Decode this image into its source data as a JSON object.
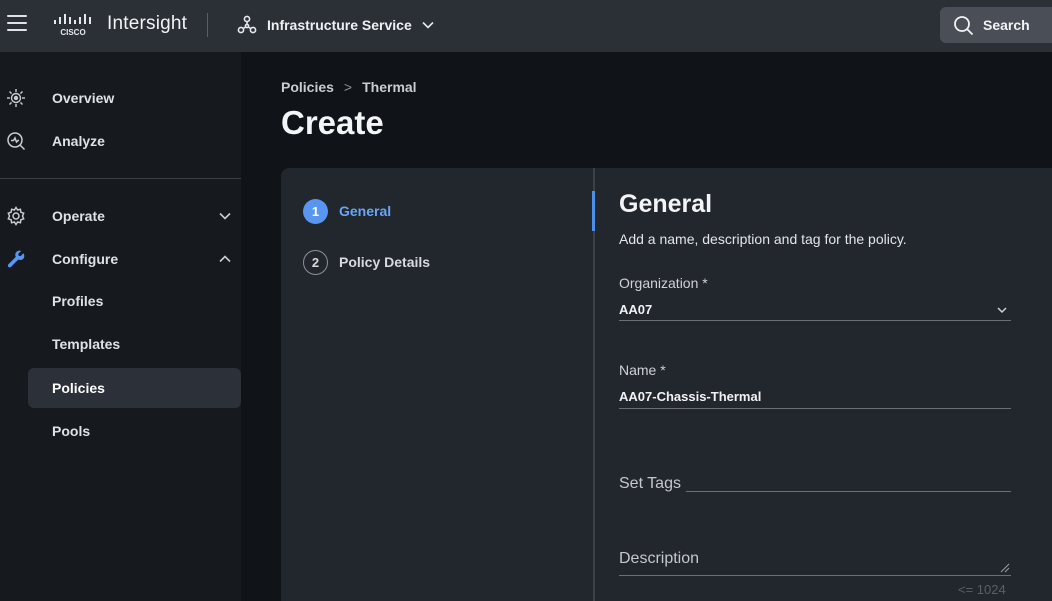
{
  "header": {
    "menu_icon": "hamburger-menu-icon",
    "logo_icon": "cisco-logo-icon",
    "app_title": "Intersight",
    "service": {
      "icon": "infrastructure-service-icon",
      "label": "Infrastructure Service",
      "chevron": "chevron-down-icon"
    },
    "search": {
      "icon": "search-icon",
      "label": "Search"
    }
  },
  "sidebar": {
    "items": [
      {
        "label": "Overview",
        "icon": "overview-icon"
      },
      {
        "label": "Analyze",
        "icon": "analyze-icon"
      },
      {
        "label": "Operate",
        "icon": "operate-gear-icon",
        "expanded": false
      },
      {
        "label": "Configure",
        "icon": "configure-wrench-icon",
        "expanded": true
      }
    ],
    "configure_children": [
      {
        "label": "Profiles",
        "active": false
      },
      {
        "label": "Templates",
        "active": false
      },
      {
        "label": "Policies",
        "active": true
      },
      {
        "label": "Pools",
        "active": false
      }
    ]
  },
  "breadcrumb": {
    "parent": "Policies",
    "separator": ">",
    "current": "Thermal"
  },
  "page_title": "Create",
  "wizard": {
    "steps": [
      {
        "number": "1",
        "label": "General",
        "active": true
      },
      {
        "number": "2",
        "label": "Policy Details",
        "active": false
      }
    ]
  },
  "form": {
    "title": "General",
    "subtitle": "Add a name, description and tag for the policy.",
    "organization": {
      "label": "Organization *",
      "value": "AA07"
    },
    "name": {
      "label": "Name *",
      "value": "AA07-Chassis-Thermal"
    },
    "tags": {
      "placeholder": "Set Tags"
    },
    "description": {
      "placeholder": "Description",
      "counter": "<= 1024"
    }
  },
  "colors": {
    "accent": "#5896ef",
    "topbar": "#2b2f36",
    "background": "#101318",
    "panel": "#22262d"
  }
}
